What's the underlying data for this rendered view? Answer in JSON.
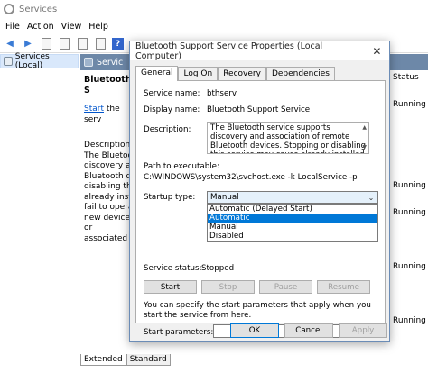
{
  "services_window": {
    "title": "Services",
    "menu": [
      "File",
      "Action",
      "View",
      "Help"
    ],
    "tree_item": "Services (Local)",
    "pane_header": "Servic",
    "selected_name": "Bluetooth S",
    "start_link": "Start",
    "start_suffix": " the serv",
    "description_label": "Description:",
    "description_lines": [
      "The Bluetoot",
      "discovery an",
      "Bluetooth de",
      "disabling thi",
      "already insta",
      "fail to operat",
      "new devices",
      "or associated"
    ],
    "status_header": "Status",
    "status_cells": [
      "Running",
      "Running",
      "Running",
      "Running",
      "Running"
    ],
    "bottom_tabs": [
      "Extended",
      "Standard"
    ]
  },
  "dialog": {
    "title": "Bluetooth Support Service Properties (Local Computer)",
    "tabs": [
      "General",
      "Log On",
      "Recovery",
      "Dependencies"
    ],
    "service_name_label": "Service name:",
    "service_name": "bthserv",
    "display_name_label": "Display name:",
    "display_name": "Bluetooth Support Service",
    "description_label": "Description:",
    "description": "The Bluetooth service supports discovery and association of remote Bluetooth devices.  Stopping or disabling this service may cause already installed",
    "path_label": "Path to executable:",
    "path": "C:\\WINDOWS\\system32\\svchost.exe -k LocalService -p",
    "startup_type_label": "Startup type:",
    "startup_type_value": "Manual",
    "startup_options": [
      "Automatic (Delayed Start)",
      "Automatic",
      "Manual",
      "Disabled"
    ],
    "service_status_label": "Service status:",
    "service_status": "Stopped",
    "buttons": {
      "start": "Start",
      "stop": "Stop",
      "pause": "Pause",
      "resume": "Resume"
    },
    "hint": "You can specify the start parameters that apply when you start the service from here.",
    "start_params_label": "Start parameters:",
    "ok": "OK",
    "cancel": "Cancel",
    "apply": "Apply"
  }
}
